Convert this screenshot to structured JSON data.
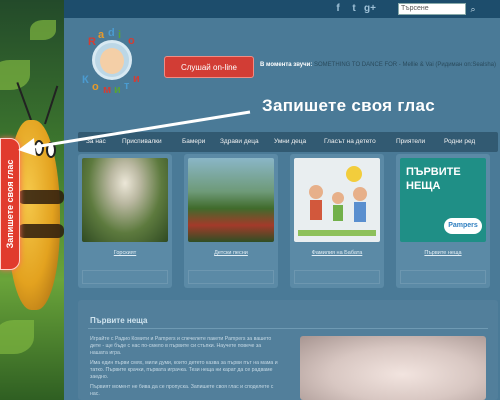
{
  "topbar": {
    "social": [
      "f",
      "t",
      "g+"
    ],
    "search_placeholder": "Търсене",
    "search_button": "⌕"
  },
  "header": {
    "logo_letters": [
      "R",
      "a",
      "d",
      "i",
      "o",
      "К",
      "о",
      "м",
      "и",
      "т",
      "и"
    ],
    "listen_button": "Слушай on-line",
    "now_playing_label": "В момента звучи:",
    "now_playing_track": "SOMETHING TO DANCE FOR - Mellie & Vai (Ридиман on:Sealsha)"
  },
  "callout": {
    "text": "Запишете своя глас"
  },
  "record_tab": {
    "label": "Запишете своя глас"
  },
  "nav": {
    "items": [
      "За нас",
      "Приспивалки",
      "Бамери",
      "Здрави деца",
      "Умни деца",
      "Гласът на детето",
      "Приятели",
      "Родни ред"
    ]
  },
  "cards": [
    {
      "caption": "Горският"
    },
    {
      "caption": "Детски песни"
    },
    {
      "caption": "Фамилия на Бабата"
    },
    {
      "caption": "Първите неща",
      "promo_title_1": "ПЪРВИТЕ",
      "promo_title_2": "НЕЩА",
      "brand": "Pampers"
    }
  ],
  "content": {
    "title": "Първите неща",
    "paragraphs": [
      "Играйте с Радио Комити и Pampers и спечелете пакети Pampers за вашето дете - щe бъде с нас по-смело в първите си стъпки. Научете повече за нашата игра.",
      "Има един първи смях, мили думи, които детето казва за първи път на мама и татко. Първите крачки, първата играчка. Тези неща ни карат да се радваме заедно.",
      "Първият момент не бива да се пропуска. Запишете своя глас и споделете с нас."
    ]
  },
  "colors": {
    "record_red": "#e13b2d",
    "listen_red": "#d23d35",
    "nav_bg": "#325a72",
    "promo_teal": "#1f8f86"
  }
}
